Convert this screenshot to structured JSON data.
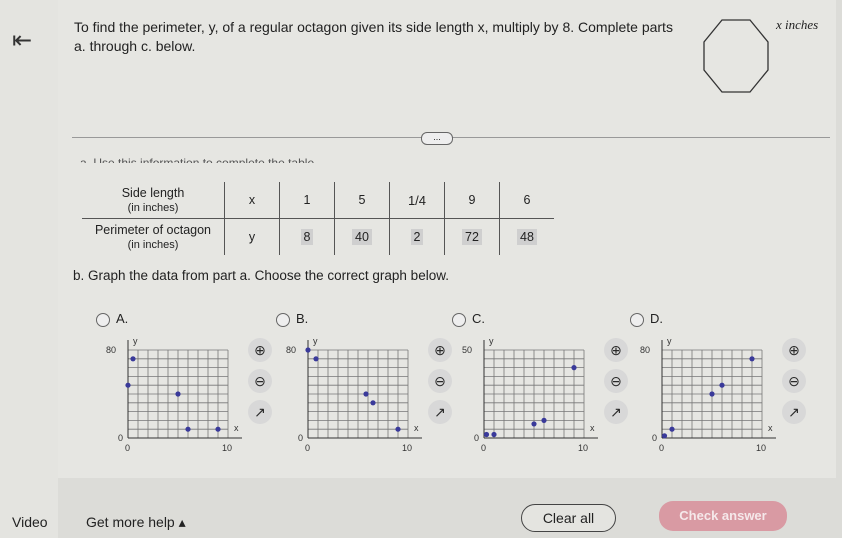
{
  "prompt": "To find the perimeter, y, of a regular octagon given its side length x, multiply by 8. Complete parts a. through c. below.",
  "figure_label": "x inches",
  "more_label": "...",
  "part_a": "a. Use this information to complete the table.",
  "table": {
    "row1_label": "Side length",
    "row1_sub": "(in inches)",
    "row1_var": "x",
    "row2_label": "Perimeter of octagon",
    "row2_sub": "(in inches)",
    "row2_var": "y",
    "x_values": [
      "1",
      "5",
      "1/4",
      "9",
      "6"
    ],
    "y_values": [
      "8",
      "40",
      "2",
      "72",
      "48"
    ]
  },
  "part_b": "b. Graph the data from part a. Choose the correct graph below.",
  "options": [
    "A.",
    "B.",
    "C.",
    "D."
  ],
  "footer": {
    "video": "Video",
    "help": "Get more help ▴",
    "clear": "Clear all",
    "check": "Check answer"
  },
  "colors": {
    "point": "#3a3a9a",
    "check_button": "#d99aa3"
  },
  "chart_data": [
    {
      "type": "scatter",
      "option": "A.",
      "xlim": [
        0,
        10
      ],
      "ylim": [
        0,
        80
      ],
      "x_tick_labels": [
        "0",
        "10"
      ],
      "y_tick_labels": [
        "0",
        "80"
      ],
      "xlabel": "x",
      "ylabel": "y",
      "grid": true,
      "points": [
        [
          0.5,
          72
        ],
        [
          0,
          48
        ],
        [
          5,
          40
        ],
        [
          6,
          8
        ],
        [
          9,
          8
        ]
      ]
    },
    {
      "type": "scatter",
      "option": "B.",
      "xlim": [
        0,
        10
      ],
      "ylim": [
        0,
        80
      ],
      "x_tick_labels": [
        "0",
        "10"
      ],
      "y_tick_labels": [
        "0",
        "80"
      ],
      "xlabel": "x",
      "ylabel": "y",
      "grid": true,
      "points": [
        [
          0,
          80
        ],
        [
          0.8,
          72
        ],
        [
          5.8,
          40
        ],
        [
          6.5,
          32
        ],
        [
          9,
          8
        ]
      ]
    },
    {
      "type": "scatter",
      "option": "C.",
      "xlim": [
        0,
        10
      ],
      "ylim": [
        0,
        50
      ],
      "x_tick_labels": [
        "0",
        "10"
      ],
      "y_tick_labels": [
        "0",
        "50"
      ],
      "xlabel": "x",
      "ylabel": "y",
      "grid": true,
      "points": [
        [
          0.25,
          2
        ],
        [
          1,
          2
        ],
        [
          5,
          8
        ],
        [
          6,
          10
        ],
        [
          9,
          40
        ]
      ]
    },
    {
      "type": "scatter",
      "option": "D.",
      "xlim": [
        0,
        10
      ],
      "ylim": [
        0,
        80
      ],
      "x_tick_labels": [
        "0",
        "10"
      ],
      "y_tick_labels": [
        "0",
        "80"
      ],
      "xlabel": "x",
      "ylabel": "y",
      "grid": true,
      "points": [
        [
          0.25,
          2
        ],
        [
          1,
          8
        ],
        [
          5,
          40
        ],
        [
          6,
          48
        ],
        [
          9,
          72
        ]
      ]
    }
  ]
}
